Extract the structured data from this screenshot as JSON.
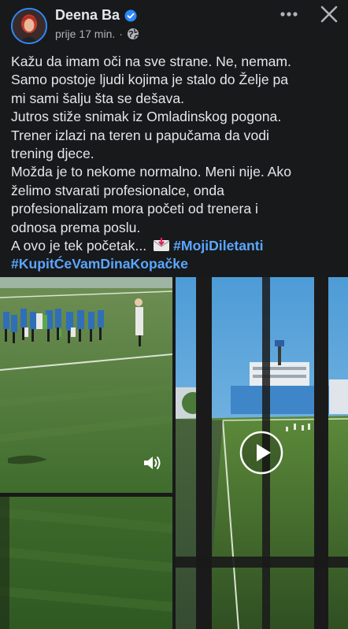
{
  "header": {
    "author_name": "Deena Ba",
    "timestamp": "prije 17 min.",
    "separator": "·",
    "audience_icon": "globe-icon",
    "verified_icon": "verified-badge-icon",
    "more_icon": "more-dots-icon",
    "close_icon": "close-icon"
  },
  "post": {
    "lines": [
      "Kažu da imam oči na sve strane. Ne, nemam.",
      "Samo postoje ljudi kojima je stalo do Želje pa",
      "mi sami šalju šta se dešava.",
      "Jutros stiže snimak iz Omladinskog pogona.",
      "Trener izlazi na teren u papučama da vodi",
      "trening djece.",
      "Možda je to nekome normalno. Meni nije. Ako",
      "želimo stvarati profesionalce, onda",
      "profesionalizam mora početi od trenera i",
      "odnosa prema poslu."
    ],
    "last_line_text": "A ovo je tek početak...",
    "emoji_icon": "envelope-arrow-icon",
    "hashtag_1": "#MojiDiletanti",
    "hashtag_2": "#KupitĆeVamDinaKopačke"
  },
  "media": {
    "sound_icon": "speaker-icon",
    "play_icon": "play-icon"
  },
  "colors": {
    "background": "#18191a",
    "text": "#e4e6eb",
    "secondary_text": "#b0b3b8",
    "hashtag": "#5aa7ff",
    "verified": "#2d88ff"
  }
}
